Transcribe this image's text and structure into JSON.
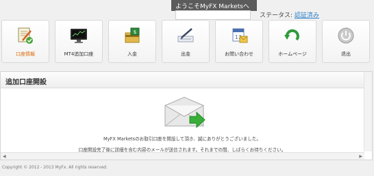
{
  "header": {
    "welcome": "ようこそMyFX Marketsへ",
    "status_label": "ステータス:",
    "status_value": "認証済み"
  },
  "tiles": [
    {
      "label": "口座情報",
      "icon": "document-pen-icon",
      "active": true
    },
    {
      "label": "MT4追加口座",
      "icon": "monitor-chart-icon"
    },
    {
      "label": "入金",
      "icon": "deposit-card-icon"
    },
    {
      "label": "出金",
      "icon": "withdraw-pen-icon"
    },
    {
      "label": "お問い合わせ",
      "icon": "calendar-contact-icon"
    },
    {
      "label": "ホームページ",
      "icon": "green-arrow-home-icon"
    },
    {
      "label": "退出",
      "icon": "power-icon"
    }
  ],
  "panel": {
    "title": "追加口座開設",
    "message1": "MyFX Marketsのお取引口座を開設して頂き、誠にありがとうございました。",
    "message2": "口座開設完了後に詳細を含む内容のメールが送信されます。それまでの間、しばらくお待ちください。"
  },
  "footer": {
    "copyright": "Copyright © 2012 - 2013 MyFx. All rights reserved."
  },
  "colors": {
    "active_label": "#e06a0a",
    "status_link": "#2a7fc9",
    "welcome_bg": "#5b5b5b"
  }
}
